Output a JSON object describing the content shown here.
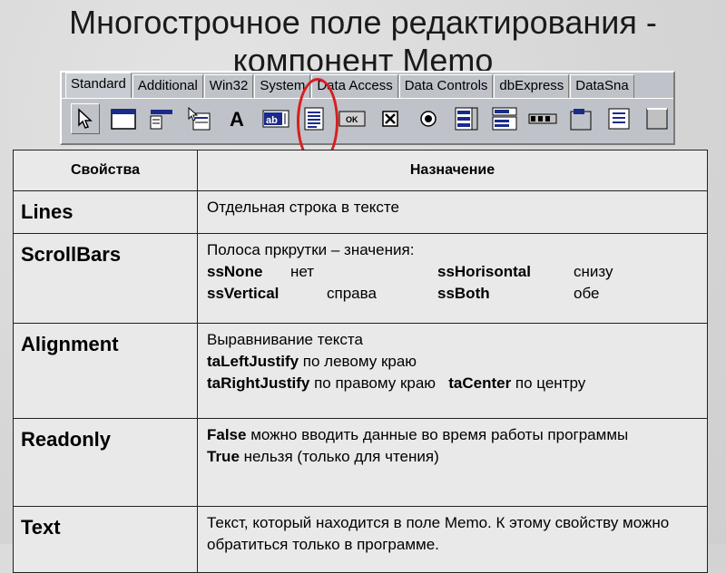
{
  "title": {
    "line1": "Многострочное поле редактирования -",
    "line2": "компонент Memo"
  },
  "palette": {
    "tabs": [
      "Standard",
      "Additional",
      "Win32",
      "System",
      "Data Access",
      "Data Controls",
      "dbExpress",
      "DataSna"
    ],
    "active_tab": "Standard",
    "icons": [
      "cursor-icon",
      "frame-icon",
      "main-menu-icon",
      "popup-menu-icon",
      "label-icon",
      "edit-icon",
      "memo-icon",
      "button-icon",
      "checkbox-icon",
      "radiobutton-icon",
      "listbox-icon",
      "combobox-icon",
      "scrollbar-icon",
      "groupbox-icon",
      "radiogroup-icon",
      "panel-icon"
    ],
    "edit_icon_text": "ab",
    "button_icon_text": "OK",
    "highlight_color": "#d81e1e"
  },
  "table": {
    "headers": [
      "Свойства",
      "Назначение"
    ],
    "rows": {
      "lines": {
        "prop": "Lines",
        "desc": "Отдельная строка в тексте"
      },
      "scrollbars": {
        "prop": "ScrollBars",
        "intro": "Полоса пркрутки – значения:",
        "ssnone": "ssNone",
        "ssnone_val": "нет",
        "sshorisontal": "ssHorisontal",
        "sshorisontal_val": "снизу",
        "ssvertical": "ssVertical",
        "ssvertical_val": "справа",
        "ssboth": "ssBoth",
        "ssboth_val": "обе"
      },
      "alignment": {
        "prop": "Alignment",
        "intro": "Выравнивание текста",
        "left": "taLeftJustify",
        "left_val": " по левому краю",
        "right": "taRightJustify",
        "right_val": " по правому краю",
        "center": "taCenter",
        "center_val": " по центру"
      },
      "readonly": {
        "prop": "Readonly",
        "false_kw": "False",
        "false_val": " можно вводить данные во время работы программы",
        "true_kw": "True",
        "true_val": " нельзя (только для чтения)"
      },
      "text": {
        "prop": "Text",
        "desc": "Текст, который находится в поле Memo. К этому свойству можно обратиться только в программе."
      }
    }
  }
}
